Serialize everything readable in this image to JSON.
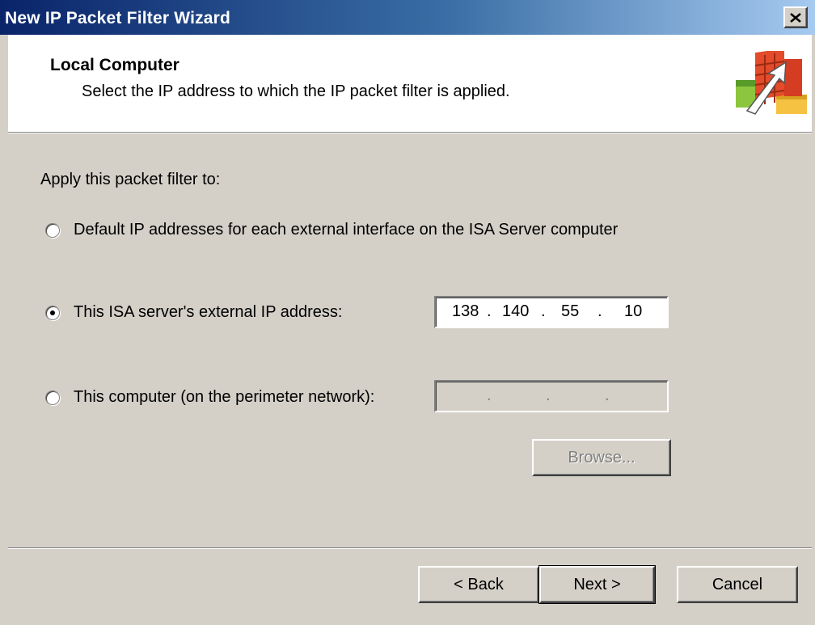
{
  "window": {
    "title": "New IP Packet Filter Wizard"
  },
  "header": {
    "title": "Local Computer",
    "subtitle": "Select the IP address to which the IP packet filter is applied.",
    "icon": "firewall-arrow-icon"
  },
  "body": {
    "apply_label": "Apply this packet filter to:",
    "options": [
      {
        "label": "Default IP addresses for each external interface on the ISA Server computer",
        "checked": false
      },
      {
        "label": "This ISA server's external IP address:",
        "checked": true
      },
      {
        "label": "This computer (on the perimeter network):",
        "checked": false
      }
    ],
    "external_ip": {
      "o1": "138",
      "o2": "140",
      "o3": "55",
      "o4": "10",
      "dot": "."
    },
    "perimeter_ip": {
      "dot": "."
    },
    "browse_label": "Browse..."
  },
  "footer": {
    "back_label": "< Back",
    "next_label": "Next >",
    "cancel_label": "Cancel"
  }
}
